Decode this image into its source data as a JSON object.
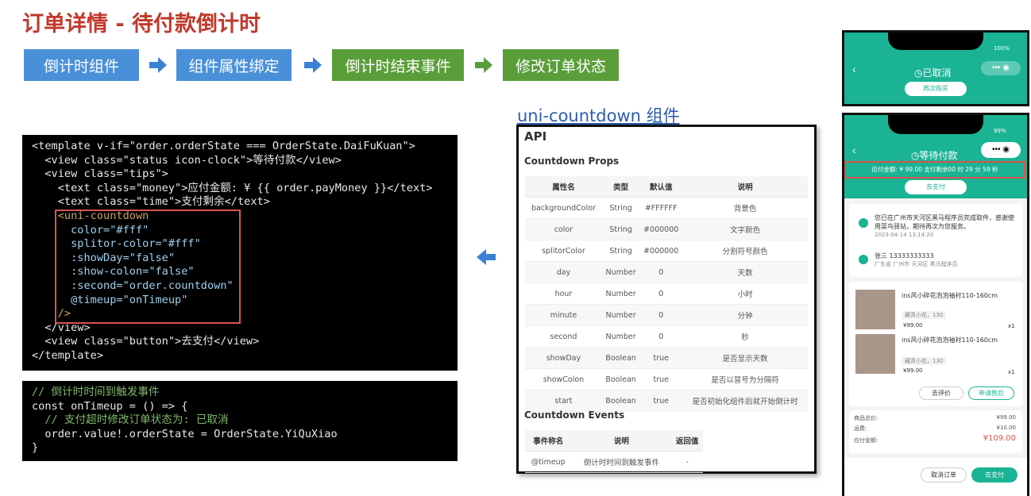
{
  "title": "订单详情 - 待付款倒计时",
  "steps": [
    "倒计时组件",
    "组件属性绑定",
    "倒计时结束事件",
    "修改订单状态"
  ],
  "colors": {
    "title": "#c0392b",
    "step_blue": "#4a90d9",
    "step_green": "#5a9e3a",
    "arrow": "#3b82d6",
    "teal": "#1ab394",
    "highlight": "#d9534f"
  },
  "code_template": [
    "<template v-if=\"order.orderState === OrderState.DaiFuKuan\">",
    "  <view class=\"status icon-clock\">等待付款</view>",
    "  <view class=\"tips\">",
    "    <text class=\"money\">应付金额: ¥ {{ order.payMoney }}</text>",
    "    <text class=\"time\">支付剩余</text>",
    "    <uni-countdown",
    "      color=\"#fff\"",
    "      splitor-color=\"#fff\"",
    "      :showDay=\"false\"",
    "      :show-colon=\"false\"",
    "      :second=\"order.countdown\"",
    "      @timeup=\"onTimeup\"",
    "    />",
    "  </view>",
    "  <view class=\"button\">去支付</view>",
    "</template>"
  ],
  "code_script": [
    "// 倒计时时间到触发事件",
    "const onTimeup = () => {",
    "  // 支付超时修改订单状态为: 已取消",
    "  order.value!.orderState = OrderState.YiQuXiao",
    "}"
  ],
  "api": {
    "link": "uni-countdown 组件",
    "heading": "API",
    "props_title": "Countdown Props",
    "props_headers": [
      "属性名",
      "类型",
      "默认值",
      "说明"
    ],
    "props": [
      [
        "backgroundColor",
        "String",
        "#FFFFFF",
        "背景色"
      ],
      [
        "color",
        "String",
        "#000000",
        "文字颜色"
      ],
      [
        "splitorColor",
        "String",
        "#000000",
        "分割符号颜色"
      ],
      [
        "day",
        "Number",
        "0",
        "天数"
      ],
      [
        "hour",
        "Number",
        "0",
        "小时"
      ],
      [
        "minute",
        "Number",
        "0",
        "分钟"
      ],
      [
        "second",
        "Number",
        "0",
        "秒"
      ],
      [
        "showDay",
        "Boolean",
        "true",
        "是否显示天数"
      ],
      [
        "showColon",
        "Boolean",
        "true",
        "是否以冒号为分隔符"
      ],
      [
        "start",
        "Boolean",
        "true",
        "是否初始化组件后就开始倒计时"
      ]
    ],
    "events_title": "Countdown Events",
    "events_headers": [
      "事件称名",
      "说明",
      "返回值"
    ],
    "events": [
      [
        "@timeup",
        "倒计时时间到触发事件",
        "-"
      ]
    ]
  },
  "phone1": {
    "battery": "100%",
    "status": "已取消",
    "button": "再次购买"
  },
  "phone2": {
    "battery": "99%",
    "status": "等待付款",
    "tips": "应付金额: ¥ 99.00   支付剩余00 时 29 分 59 秒",
    "pay_button": "去支付",
    "delivery_text": "您已在广州市天河区黑马程序员完成取件，感谢使用菜鸟驿站，期待再次为您服务。",
    "delivery_time": "2023-04-14 13:14:20",
    "address_name": "张三 13333333333",
    "address_detail": "广东省 广州市 天河区 黑马程序员",
    "products": [
      {
        "name": "ins风小碎花泡泡袖衬110-160cm",
        "spec": "藏青小花，130",
        "price": "¥99.00",
        "qty": "x1"
      },
      {
        "name": "ins风小碎花泡泡袖衬110-160cm",
        "spec": "藏青小花，130",
        "price": "¥99.00",
        "qty": "x1"
      }
    ],
    "btn_review": "去评价",
    "btn_aftersale": "申请售后",
    "summary": [
      [
        "商品总价:",
        "¥99.00"
      ],
      [
        "运费:",
        "¥10.00"
      ],
      [
        "应付金额:",
        "¥109.00"
      ]
    ],
    "btn_cancel": "取消订单",
    "btn_pay": "去支付"
  }
}
